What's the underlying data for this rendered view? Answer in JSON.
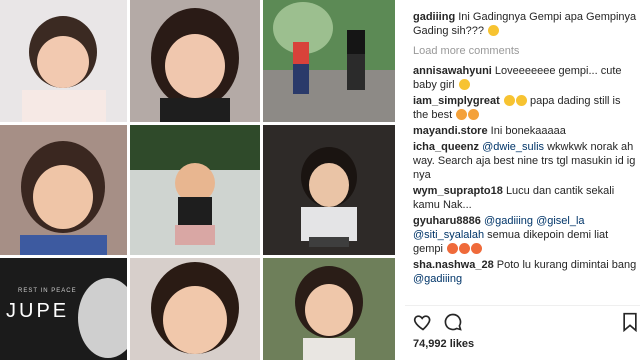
{
  "grid": {
    "banner_small": "REST IN PEACE",
    "banner_big": "JUPE"
  },
  "comments": [
    {
      "user": "gadiiing",
      "text": "Ini Gadingnya Gempi apa Gempinya Gading sih???"
    },
    {
      "type": "load",
      "text": "Load more comments"
    },
    {
      "user": "annisawahyuni",
      "text": "Loveeeeeee gempi... cute baby girl"
    },
    {
      "user": "iam_simplygreat",
      "text": "papa dading still is the best"
    },
    {
      "user": "mayandi.store",
      "text": "Ini bonekaaaaa"
    },
    {
      "user": "icha_queenz",
      "mention": "@dwie_sulis",
      "text": "wkwkwk norak ah way. Search aja best nine trs tgl masukin id ig nya"
    },
    {
      "user": "wym_suprapto18",
      "text": "Lucu dan cantik sekali kamu Nak..."
    },
    {
      "user": "gyuharu8886",
      "mention": "@gadiiing @gisel_la @siti_syalalah",
      "text": "semua dikepoin demi liat gempi"
    },
    {
      "user": "sha.nashwa_28",
      "text": "Poto lu kurang dimintai bang",
      "mention2": "@gadiiing"
    }
  ],
  "actions": {
    "like_icon": "heart-icon",
    "comment_icon": "comment-icon",
    "bookmark_icon": "bookmark-icon"
  },
  "likes": "74,992 likes"
}
